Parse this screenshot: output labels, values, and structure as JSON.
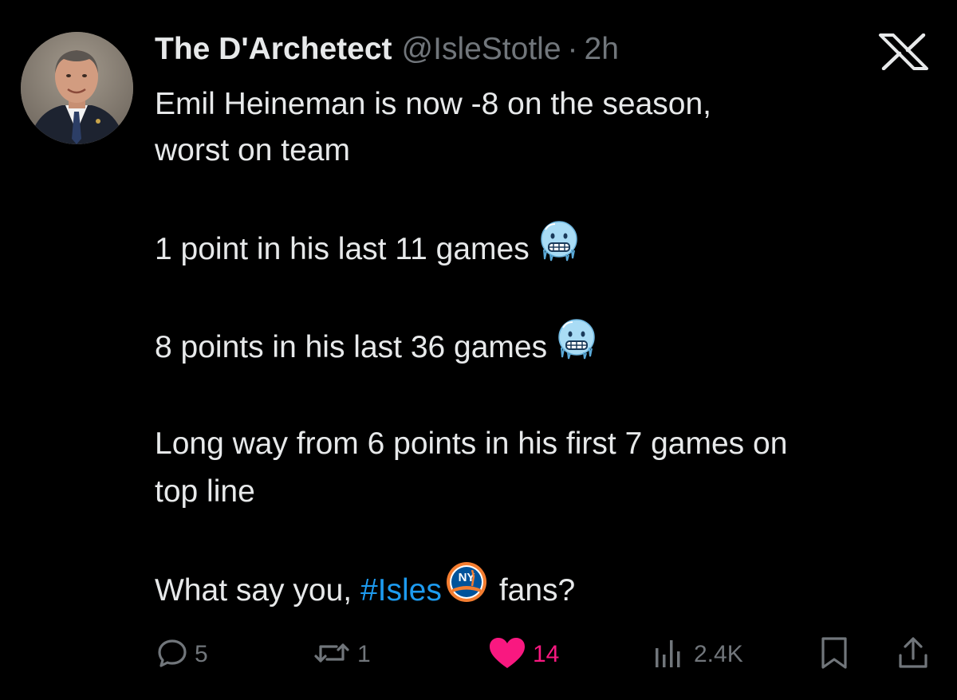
{
  "tweet": {
    "display_name": "The D'Archetect",
    "handle": "@IsleStotle",
    "separator": "·",
    "time": "2h",
    "lines": {
      "l1": "Emil Heineman is now -8 on the season,",
      "l2": "worst on team",
      "l3": "1 point in his last 11 games",
      "l4": "8 points in his last 36 games",
      "l5": "Long way from 6 points in his first 7 games on",
      "l6": "top line",
      "l7_before": "What say you,",
      "l7_hashtag": "#Isles",
      "l7_after": "fans?"
    },
    "emoji": "cold-face",
    "team_logo": "ny-islanders-logo"
  },
  "actions": {
    "replies": "5",
    "reposts": "1",
    "likes": "14",
    "views": "2.4K"
  },
  "colors": {
    "background": "#000000",
    "text": "#e7e9ea",
    "muted": "#71767b",
    "link": "#1d9bf0",
    "like": "#f91880"
  }
}
